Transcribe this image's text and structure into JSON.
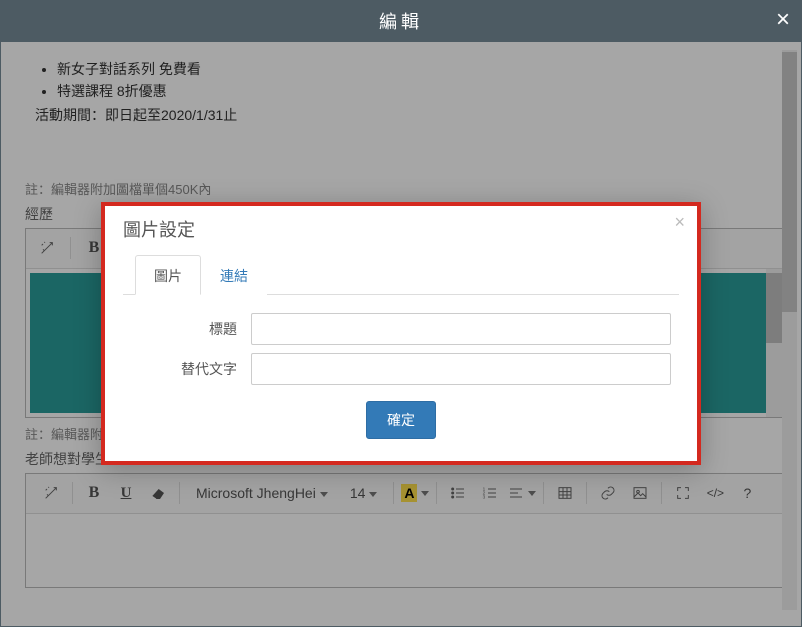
{
  "outer": {
    "title": "編輯",
    "close_icon": "×"
  },
  "content": {
    "list_items": [
      "新女子對話系列 免費看",
      "特選課程 8折優惠"
    ],
    "period": "活動期間：即日起至2020/1/31止",
    "note1": "註：編輯器附加圖檔單個450K內",
    "section1_label": "經歷",
    "note2": "註：編輯器附加",
    "section2_label": "老師想對學生"
  },
  "toolbar1": {
    "bold": "B"
  },
  "toolbar2": {
    "bold": "B",
    "under": "U",
    "font": "Microsoft JhengHei",
    "size": "14",
    "A": "A",
    "code": "</>",
    "help": "?"
  },
  "popup": {
    "title": "圖片設定",
    "close": "×",
    "tabs": {
      "image": "圖片",
      "link": "連結"
    },
    "labels": {
      "title": "標題",
      "alt": "替代文字"
    },
    "values": {
      "title": "",
      "alt": ""
    },
    "ok": "確定"
  }
}
